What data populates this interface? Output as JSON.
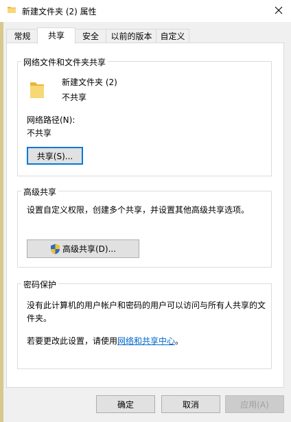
{
  "window": {
    "title": "新建文件夹 (2) 属性"
  },
  "tabs": [
    {
      "label": "常规"
    },
    {
      "label": "共享"
    },
    {
      "label": "安全"
    },
    {
      "label": "以前的版本"
    },
    {
      "label": "自定义"
    }
  ],
  "sharing": {
    "group_title": "网络文件和文件夹共享",
    "folder_name": "新建文件夹 (2)",
    "share_status": "不共享",
    "network_path_label": "网络路径(N):",
    "network_path_value": "不共享",
    "share_button": "共享(S)..."
  },
  "advanced": {
    "group_title": "高级共享",
    "description": "设置自定义权限，创建多个共享，并设置其他高级共享选项。",
    "button": "高级共享(D)..."
  },
  "password": {
    "group_title": "密码保护",
    "description_line1": "没有此计算机的用户帐户和密码的用户可以访问与所有人共享的文",
    "description_line2": "件夹。",
    "change_prefix": "若要更改此设置，请使用",
    "change_link": "网络和共享中心",
    "change_suffix": "。"
  },
  "footer": {
    "ok": "确定",
    "cancel": "取消",
    "apply": "应用(A)"
  },
  "icons": {
    "title": "folder-icon",
    "close": "close-icon",
    "folder": "folder-icon",
    "advanced_button": "shield-icon"
  },
  "colors": {
    "link": "#0066cc",
    "focus_border": "#0078d7",
    "folder_yellow": "#f8d775"
  }
}
